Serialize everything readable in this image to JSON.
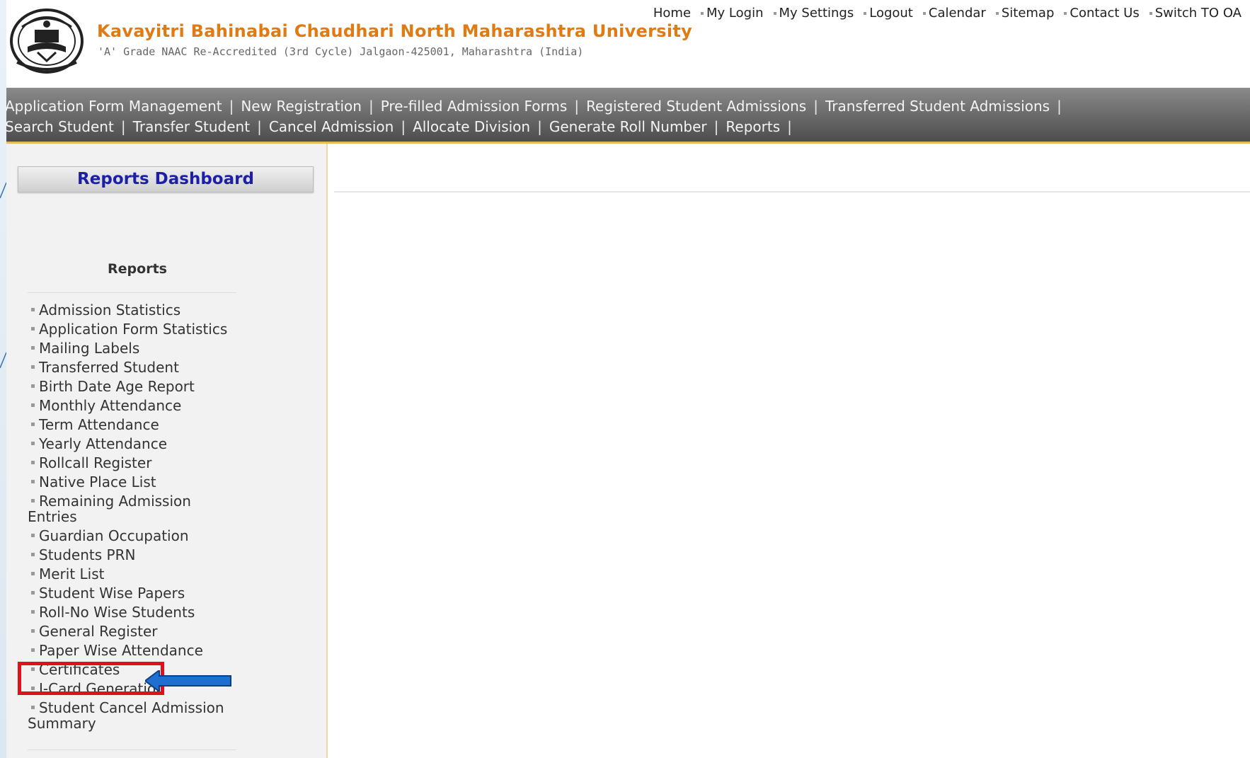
{
  "header": {
    "university_name": "Kavayitri Bahinabai Chaudhari North Maharashtra University",
    "subtitle": "'A' Grade NAAC Re-Accredited (3rd Cycle) Jalgaon-425001, Maharashtra (India)",
    "logo_icon": "university-seal-icon",
    "top_links": [
      "Home",
      "My Login",
      "My Settings",
      "Logout",
      "Calendar",
      "Sitemap",
      "Contact Us",
      "Switch TO OA"
    ]
  },
  "nav": {
    "row1": [
      "Application Form Management",
      "New Registration",
      "Pre-filled Admission Forms",
      "Registered Student Admissions",
      "Transferred Student Admissions"
    ],
    "row2": [
      "Search Student",
      "Transfer Student",
      "Cancel Admission",
      "Allocate Division",
      "Generate Roll Number",
      "Reports"
    ]
  },
  "sidebar": {
    "dashboard_title": "Reports Dashboard",
    "reports_heading": "Reports",
    "items": [
      "Admission Statistics",
      "Application Form Statistics",
      "Mailing Labels",
      "Transferred Student",
      "Birth Date Age Report",
      "Monthly Attendance",
      "Term Attendance",
      "Yearly Attendance",
      "Rollcall Register",
      "Native Place List",
      "Remaining Admission Entries",
      "Guardian Occupation",
      "Students PRN",
      "Merit List",
      "Student Wise Papers",
      "Roll-No Wise Students",
      "General Register",
      "Paper Wise Attendance",
      "Certificates",
      "I-Card Generation",
      "Student Cancel Admission Summary"
    ]
  },
  "colors": {
    "university_name": "#e07a12",
    "dashboard_title": "#1d1fa6",
    "highlight": "#e0101e",
    "arrow": "#1e6fd0"
  }
}
